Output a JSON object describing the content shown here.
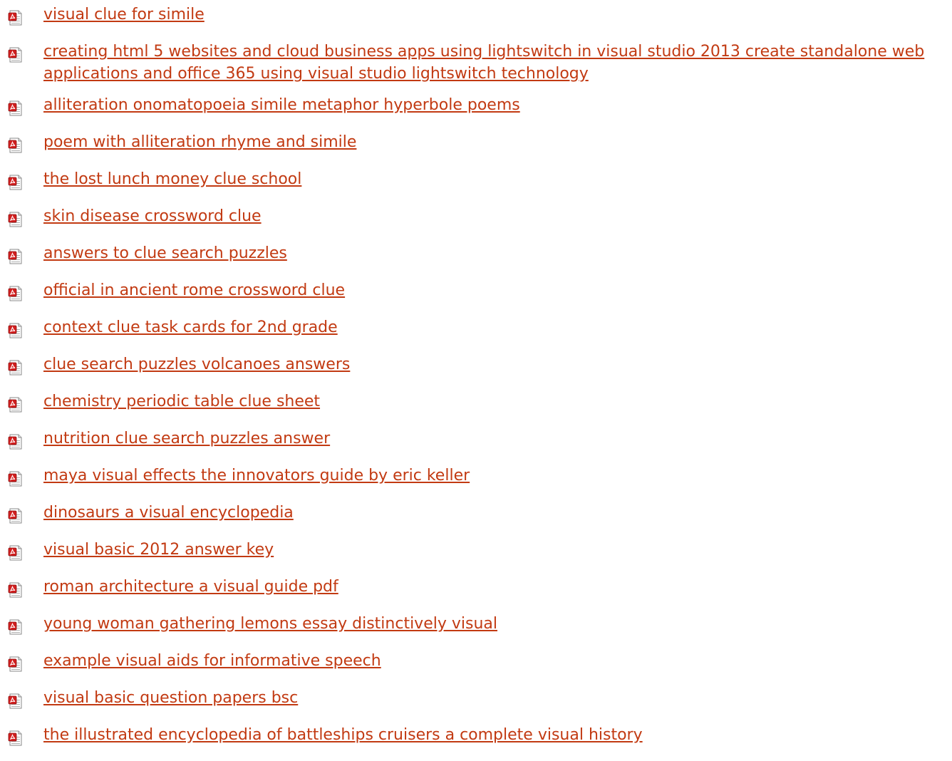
{
  "accent_color": "#c23a12",
  "items": [
    {
      "icon": "pdf-file-icon",
      "label": "visual clue for simile"
    },
    {
      "icon": "pdf-file-icon",
      "label": "creating html 5 websites and cloud business apps using lightswitch in visual studio 2013 create standalone web applications and office 365 using visual studio lightswitch technology"
    },
    {
      "icon": "pdf-file-icon",
      "label": "alliteration onomatopoeia simile metaphor hyperbole poems"
    },
    {
      "icon": "pdf-file-icon",
      "label": "poem with alliteration rhyme and simile"
    },
    {
      "icon": "pdf-file-icon",
      "label": "the lost lunch money clue school"
    },
    {
      "icon": "pdf-file-icon",
      "label": "skin disease crossword clue"
    },
    {
      "icon": "pdf-file-icon",
      "label": "answers to clue search puzzles"
    },
    {
      "icon": "pdf-file-icon",
      "label": "official in ancient rome crossword clue"
    },
    {
      "icon": "pdf-file-icon",
      "label": "context clue task cards for 2nd grade"
    },
    {
      "icon": "pdf-file-icon",
      "label": "clue search puzzles volcanoes answers"
    },
    {
      "icon": "pdf-file-icon",
      "label": "chemistry periodic table clue sheet"
    },
    {
      "icon": "pdf-file-icon",
      "label": "nutrition clue search puzzles answer"
    },
    {
      "icon": "pdf-file-icon",
      "label": "maya visual effects the innovators guide by eric keller"
    },
    {
      "icon": "pdf-file-icon",
      "label": "dinosaurs a visual encyclopedia"
    },
    {
      "icon": "pdf-file-icon",
      "label": "visual basic 2012 answer key"
    },
    {
      "icon": "pdf-file-icon",
      "label": "roman architecture a visual guide pdf"
    },
    {
      "icon": "pdf-file-icon",
      "label": "young woman gathering lemons essay distinctively visual"
    },
    {
      "icon": "pdf-file-icon",
      "label": "example visual aids for informative speech"
    },
    {
      "icon": "pdf-file-icon",
      "label": "visual basic question papers bsc"
    },
    {
      "icon": "pdf-file-icon",
      "label": "the illustrated encyclopedia of battleships cruisers a complete visual history"
    }
  ]
}
